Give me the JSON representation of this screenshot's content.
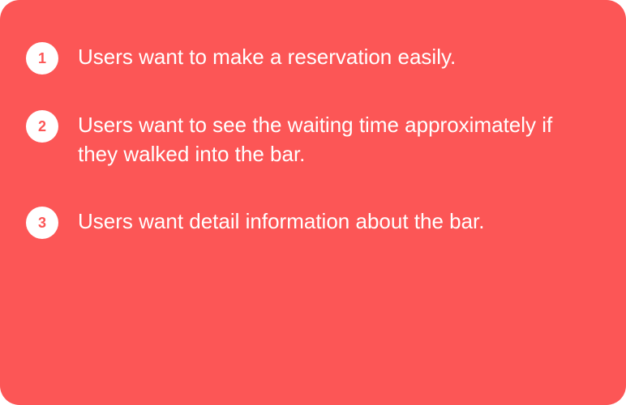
{
  "colors": {
    "card_background": "#fc5656",
    "badge_background": "#ffffff",
    "badge_text": "#fc5656",
    "text": "#ffffff"
  },
  "items": [
    {
      "number": "1",
      "text": "Users want to make a reservation easily."
    },
    {
      "number": "2",
      "text": "Users want to see the waiting time approximately if they walked into the bar."
    },
    {
      "number": "3",
      "text": "Users want detail information about the bar."
    }
  ]
}
